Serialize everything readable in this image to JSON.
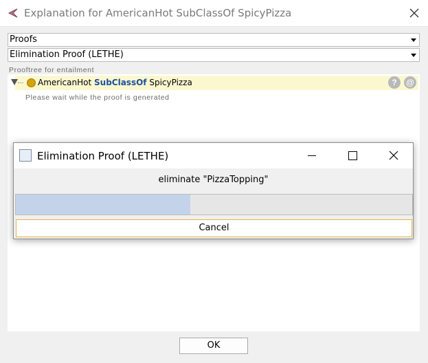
{
  "window": {
    "title": "Explanation for AmericanHot SubClassOf SpicyPizza",
    "icons": {
      "app": "protege-icon",
      "close": "close-icon"
    }
  },
  "explanation_type_select": {
    "value": "Proofs"
  },
  "proof_method_select": {
    "value": "Elimination Proof (LETHE)"
  },
  "proof_tree": {
    "label": "Prooftree for entailment",
    "axiom": {
      "subject": "AmericanHot",
      "keyword": "SubClassOf",
      "object": "SpicyPizza"
    },
    "help_button": "?",
    "at_button": "@",
    "wait_message": "Please wait while the proof is generated"
  },
  "progress_dialog": {
    "title": "Elimination Proof (LETHE)",
    "message": "eliminate \"PizzaTopping\"",
    "progress": 0.44,
    "cancel_label": "Cancel"
  },
  "ok_label": "OK",
  "colors": {
    "axiom_highlight": "#fbf8d0",
    "keyword": "#1e4fa0",
    "progress_fill": "#c3d4ea",
    "cancel_border": "#e5b54a"
  }
}
